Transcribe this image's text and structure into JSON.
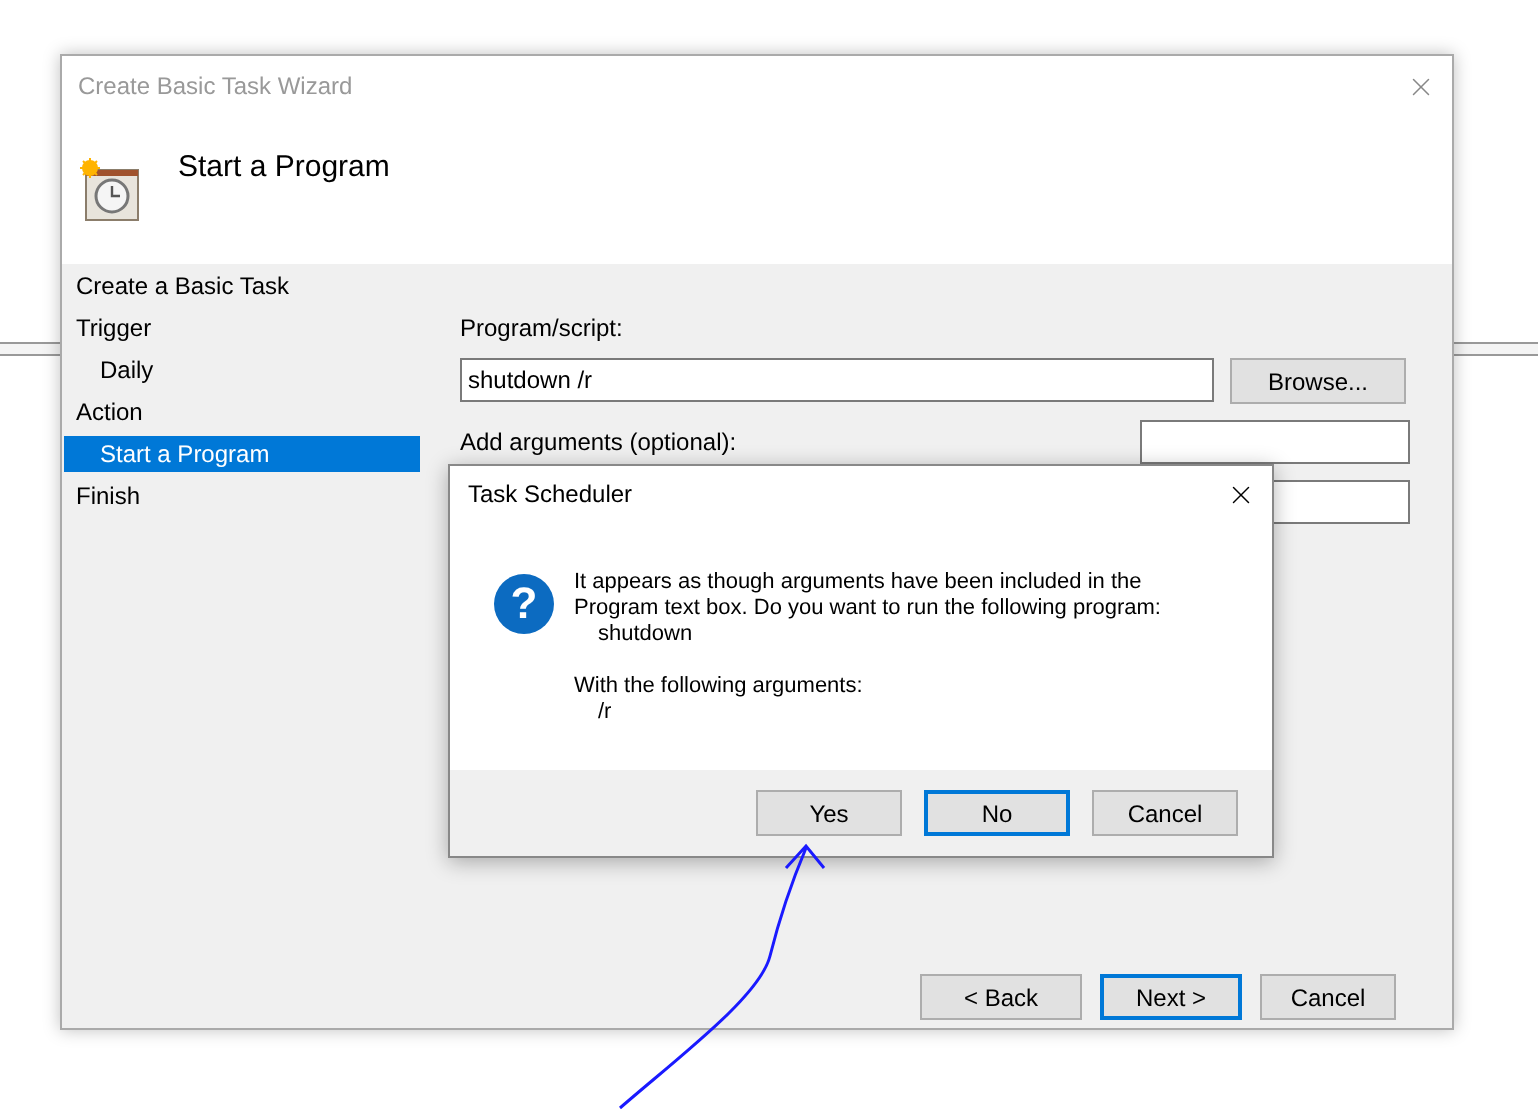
{
  "wizard": {
    "title": "Create Basic Task Wizard",
    "heading": "Start a Program",
    "steps": [
      {
        "label": "Create a Basic Task",
        "kind": "top",
        "selected": false
      },
      {
        "label": "Trigger",
        "kind": "top",
        "selected": false
      },
      {
        "label": "Daily",
        "kind": "sub",
        "selected": false
      },
      {
        "label": "Action",
        "kind": "top",
        "selected": false
      },
      {
        "label": "Start a Program",
        "kind": "sub",
        "selected": true
      },
      {
        "label": "Finish",
        "kind": "top",
        "selected": false
      }
    ],
    "program_label": "Program/script:",
    "program_value": "shutdown /r",
    "browse": "Browse...",
    "arguments_label": "Add arguments (optional):",
    "buttons": [
      {
        "label": "< Back",
        "focused": false
      },
      {
        "label": "Next >",
        "focused": true
      },
      {
        "label": "Cancel",
        "focused": false
      }
    ]
  },
  "dialog": {
    "title": "Task Scheduler",
    "question_glyph": "?",
    "message": "It appears as though arguments have been included in the Program text box. Do you want to run the following program:",
    "program": "shutdown",
    "arguments_label": "With the following arguments:",
    "arguments": "/r",
    "buttons": [
      {
        "label": "Yes",
        "focused": false
      },
      {
        "label": "No",
        "focused": true
      },
      {
        "label": "Cancel",
        "focused": false
      }
    ]
  }
}
